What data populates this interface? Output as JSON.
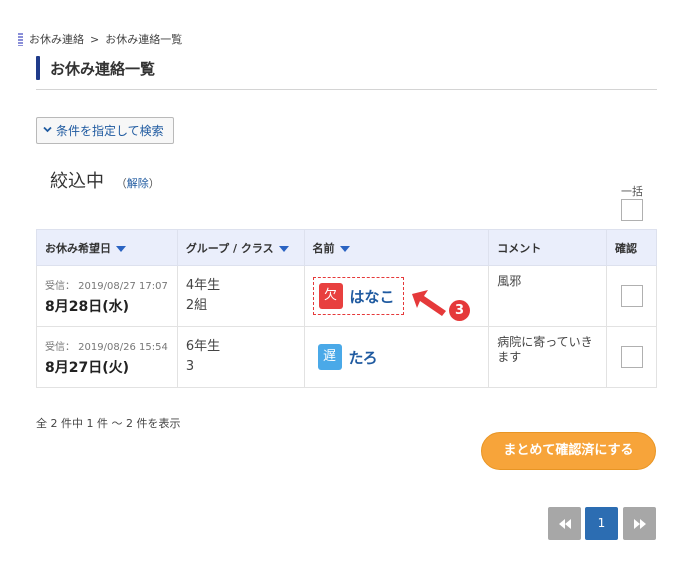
{
  "breadcrumb": {
    "home": "お休み連絡",
    "separator": ">",
    "current": "お休み連絡一覧"
  },
  "page_title": "お休み連絡一覧",
  "filter_button": {
    "label": "条件を指定して検索",
    "icon": "chevron-down-icon"
  },
  "filter_status": {
    "label": "絞込中",
    "clear_open": "（",
    "clear_link": "解除",
    "clear_close": "）"
  },
  "bulk_select": {
    "label": "一括"
  },
  "table": {
    "headers": {
      "date": "お休み希望日",
      "group": "グループ / クラス",
      "name": "名前",
      "comment": "コメント",
      "confirm": "確認"
    },
    "rows": [
      {
        "received": "受信： 2019/08/27 17:07",
        "date": "8月28日(水)",
        "group_line1": "4年生",
        "group_line2": "2組",
        "badge": "欠",
        "badge_color": "#e8403f",
        "name": "はなこ",
        "comment": "風邪"
      },
      {
        "received": "受信： 2019/08/26 15:54",
        "date": "8月27日(火)",
        "group_line1": "6年生",
        "group_line2": "3",
        "badge": "遅",
        "badge_color": "#4aa9e8",
        "name": "たろ",
        "comment": "病院に寄っていきます"
      }
    ]
  },
  "annotation": {
    "step": "3",
    "color": "#e5393a"
  },
  "count_text": "全 2 件中 1 件 〜 2 件を表示",
  "bulk_confirm_button": "まとめて確認済にする",
  "pagination": {
    "current_page": "1",
    "prev_icon": "double-chevron-left-icon",
    "next_icon": "double-chevron-right-icon"
  },
  "colors": {
    "accent": "#1f3b8a",
    "link": "#1f5aa0",
    "header_bg": "#eaeefb",
    "orange_button": "#f7a43a",
    "pager_active": "#2c6db2"
  }
}
